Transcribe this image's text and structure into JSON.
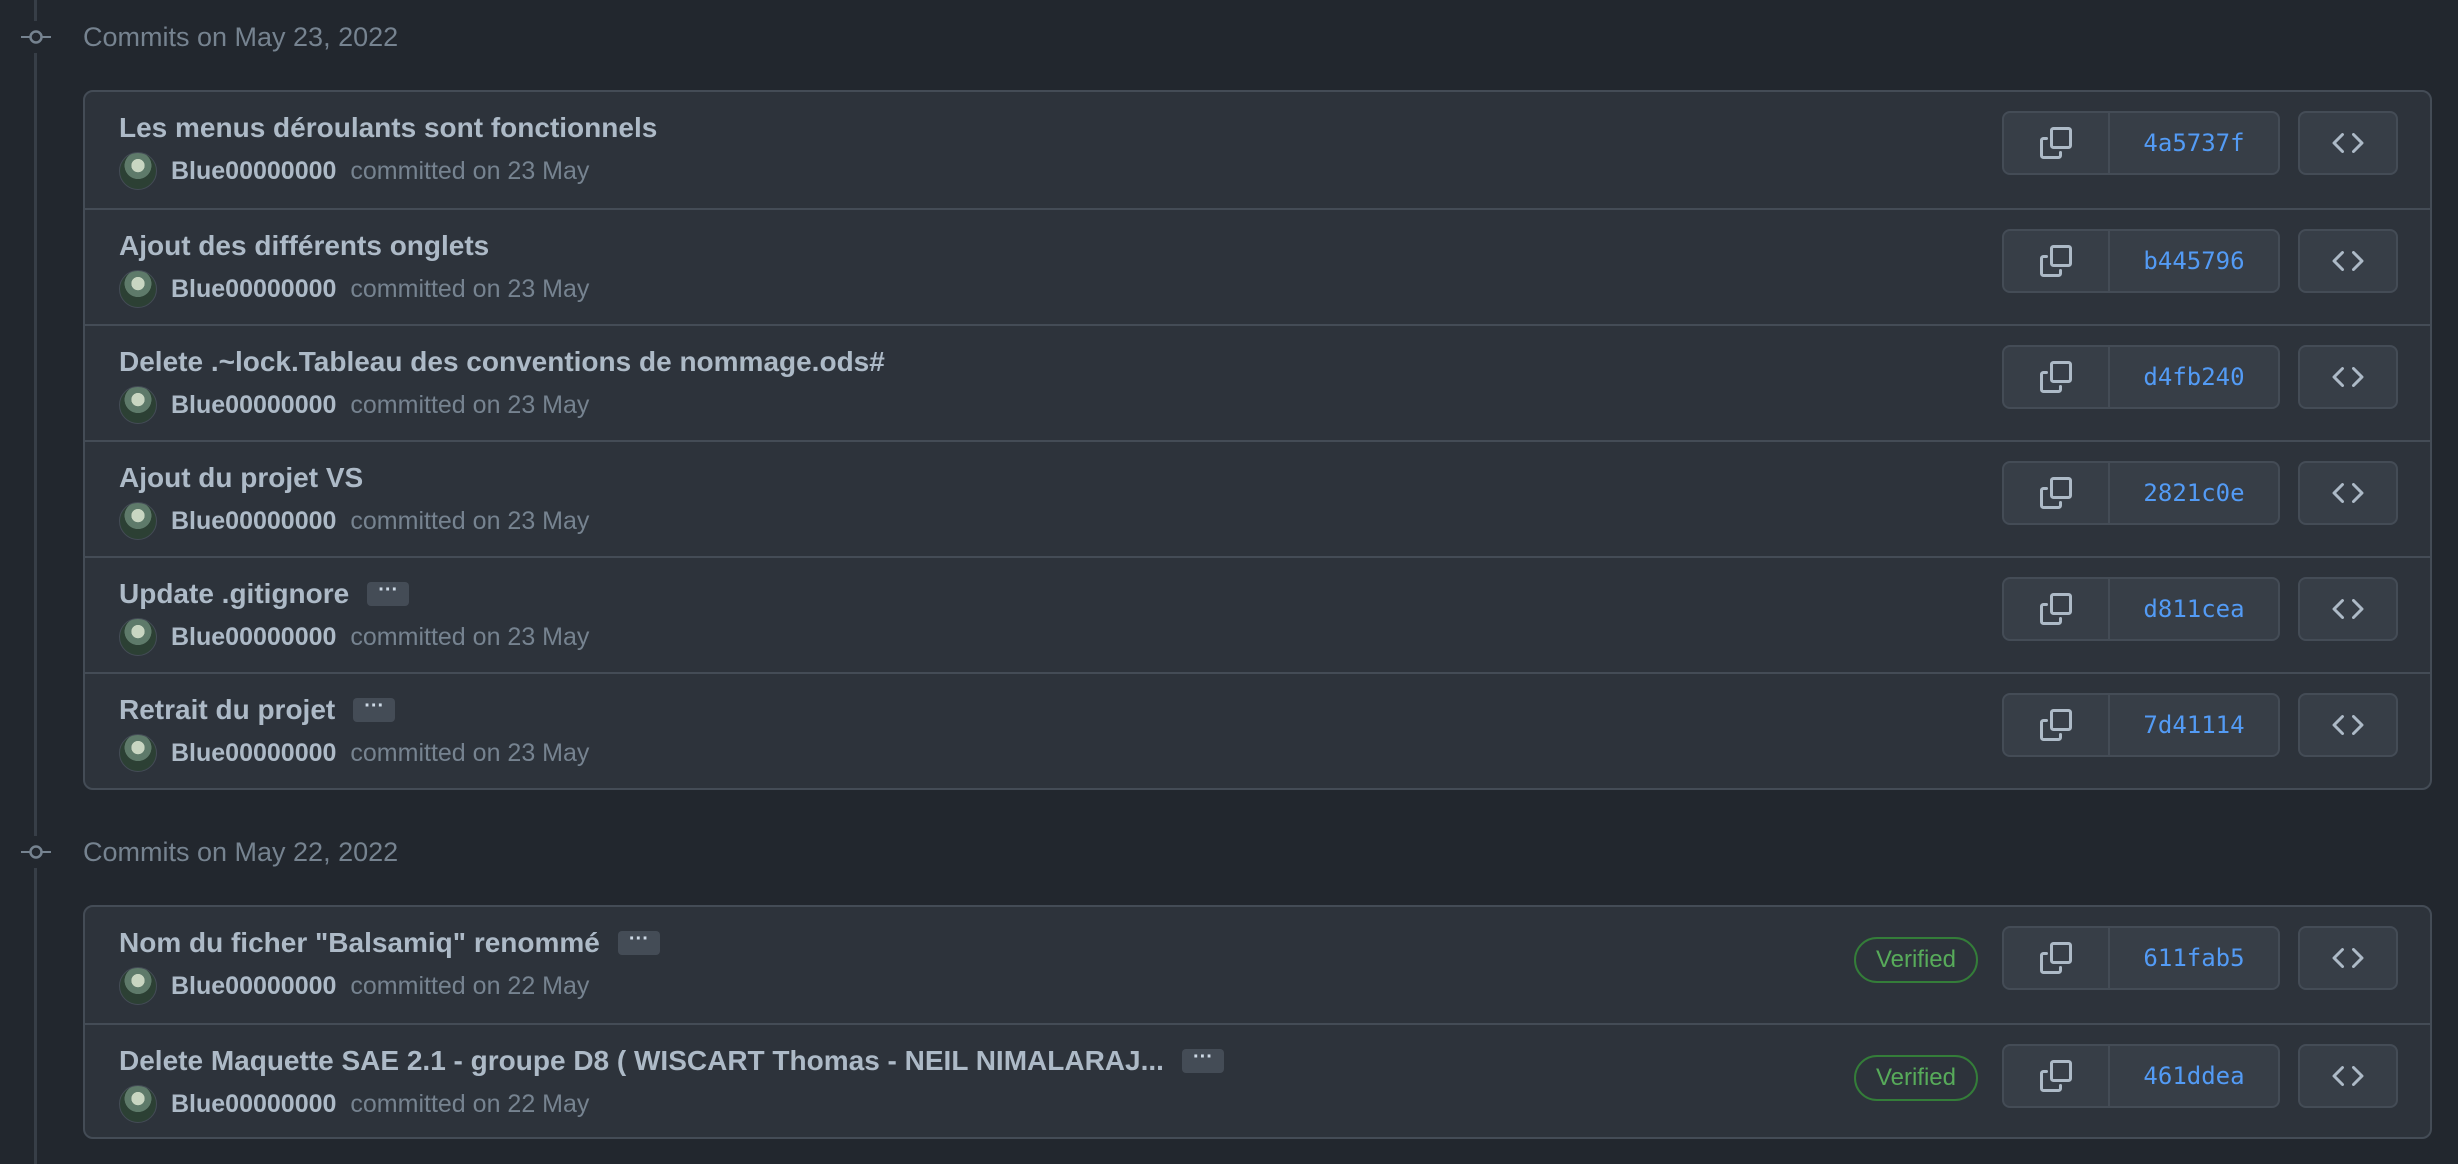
{
  "groups": [
    {
      "title": "Commits on May 23, 2022",
      "commits": [
        {
          "message": "Les menus déroulants sont fonctionnels",
          "author": "Blue00000000",
          "date": "committed on 23 May",
          "sha": "4a5737f",
          "ellipsis": "",
          "verified": ""
        },
        {
          "message": "Ajout des différents onglets",
          "author": "Blue00000000",
          "date": "committed on 23 May",
          "sha": "b445796",
          "ellipsis": "",
          "verified": ""
        },
        {
          "message": "Delete .~lock.Tableau des conventions de nommage.ods#",
          "author": "Blue00000000",
          "date": "committed on 23 May",
          "sha": "d4fb240",
          "ellipsis": "",
          "verified": ""
        },
        {
          "message": "Ajout du projet VS",
          "author": "Blue00000000",
          "date": "committed on 23 May",
          "sha": "2821c0e",
          "ellipsis": "",
          "verified": ""
        },
        {
          "message": "Update .gitignore",
          "author": "Blue00000000",
          "date": "committed on 23 May",
          "sha": "d811cea",
          "ellipsis": "···",
          "verified": ""
        },
        {
          "message": "Retrait du projet",
          "author": "Blue00000000",
          "date": "committed on 23 May",
          "sha": "7d41114",
          "ellipsis": "···",
          "verified": ""
        }
      ]
    },
    {
      "title": "Commits on May 22, 2022",
      "commits": [
        {
          "message": "Nom du ficher \"Balsamiq\" renommé",
          "author": "Blue00000000",
          "date": "committed on 22 May",
          "sha": "611fab5",
          "ellipsis": "···",
          "verified": "Verified"
        },
        {
          "message": "Delete Maquette SAE 2.1 - groupe D8 ( WISCART Thomas - NEIL NIMALARAJ...",
          "author": "Blue00000000",
          "date": "committed on 22 May",
          "sha": "461ddea",
          "ellipsis": "···",
          "verified": "Verified"
        }
      ]
    }
  ],
  "icons": {
    "commit": "git-commit-icon",
    "copy": "copy-icon",
    "code": "code-icon"
  },
  "colors": {
    "background": "#22272e",
    "sha": "#539bf5",
    "verified": "#57ab5a"
  }
}
